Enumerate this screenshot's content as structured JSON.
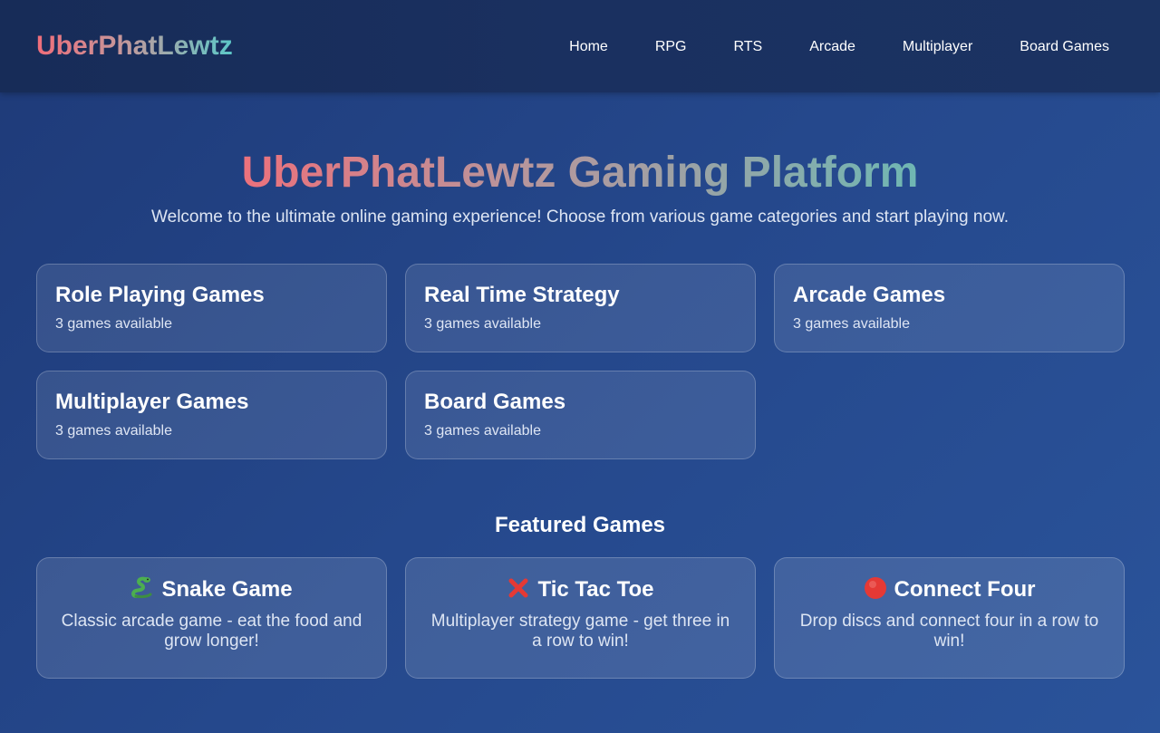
{
  "header": {
    "logo": "UberPhatLewtz",
    "nav": [
      {
        "label": "Home"
      },
      {
        "label": "RPG"
      },
      {
        "label": "RTS"
      },
      {
        "label": "Arcade"
      },
      {
        "label": "Multiplayer"
      },
      {
        "label": "Board Games"
      }
    ]
  },
  "hero": {
    "title": "UberPhatLewtz Gaming Platform",
    "subtitle": "Welcome to the ultimate online gaming experience! Choose from various game categories and start playing now."
  },
  "categories": [
    {
      "title": "Role Playing Games",
      "count": "3 games available"
    },
    {
      "title": "Real Time Strategy",
      "count": "3 games available"
    },
    {
      "title": "Arcade Games",
      "count": "3 games available"
    },
    {
      "title": "Multiplayer Games",
      "count": "3 games available"
    },
    {
      "title": "Board Games",
      "count": "3 games available"
    }
  ],
  "featured": {
    "heading": "Featured Games",
    "games": [
      {
        "icon": "snake-icon",
        "title": "Snake Game",
        "description": "Classic arcade game - eat the food and grow longer!"
      },
      {
        "icon": "cross-mark-icon",
        "title": "Tic Tac Toe",
        "description": "Multiplayer strategy game - get three in a row to win!"
      },
      {
        "icon": "red-circle-icon",
        "title": "Connect Four",
        "description": "Drop discs and connect four in a row to win!"
      }
    ]
  },
  "colors": {
    "background": "#25488c",
    "navbar": "#1a3060",
    "gradient_start": "#ef6d7a",
    "gradient_end": "#5cc8c8"
  }
}
